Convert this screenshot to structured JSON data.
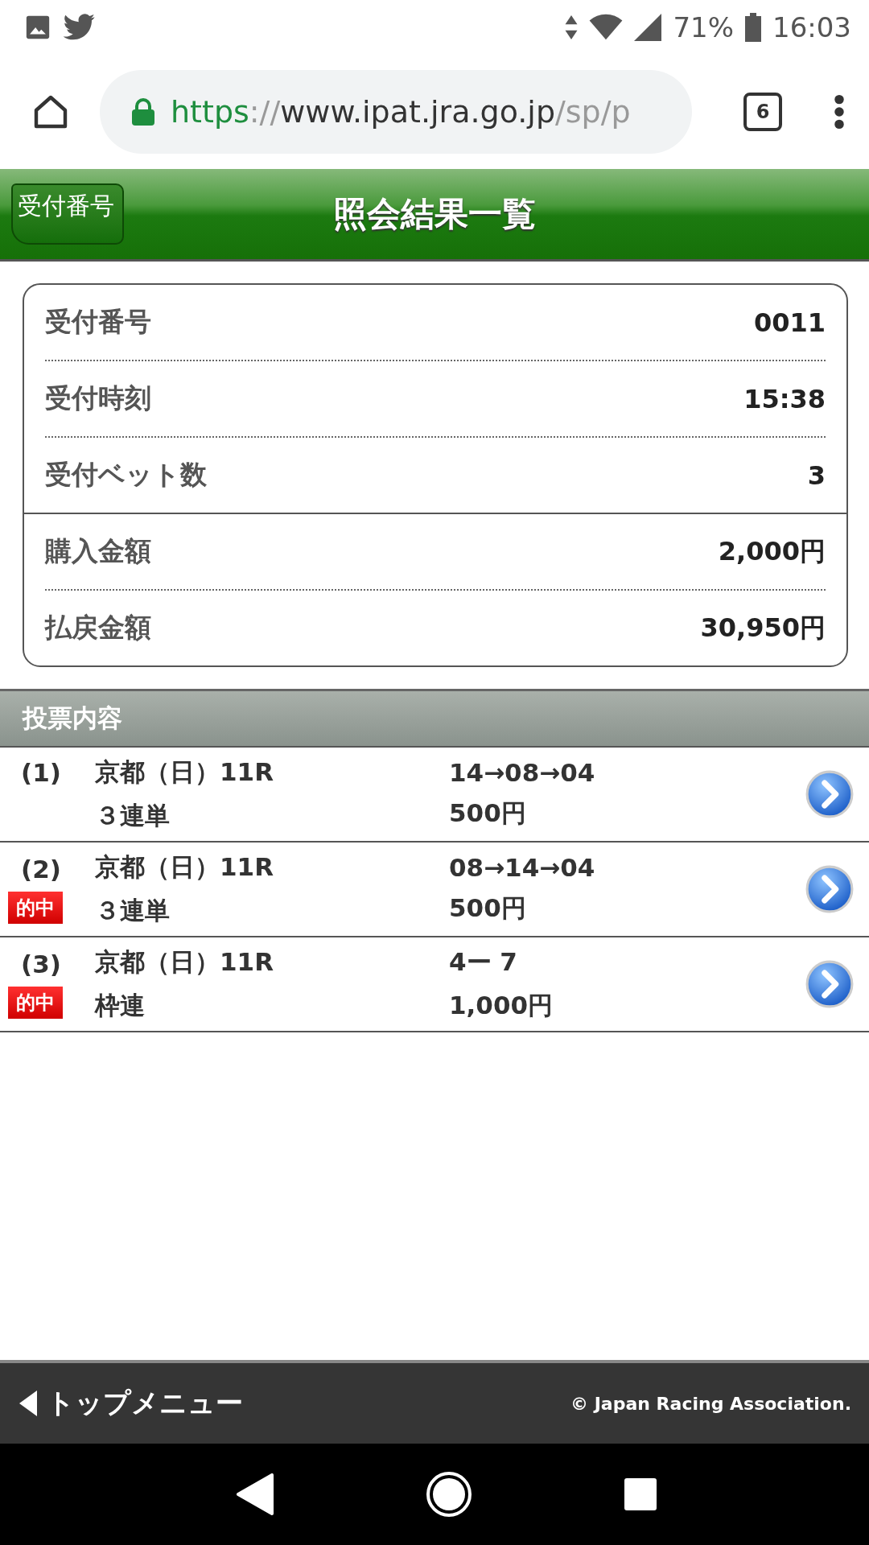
{
  "status_bar": {
    "battery": "71%",
    "time": "16:03"
  },
  "browser": {
    "url": [
      {
        "kind": "scheme",
        "text": "https"
      },
      {
        "kind": "dim",
        "text": "://"
      },
      {
        "kind": "host",
        "text": "www.ipat.jra.go.jp"
      },
      {
        "kind": "dim",
        "text": "/sp/p"
      }
    ],
    "tab_count": "6"
  },
  "header": {
    "back_label": "受付番号",
    "title": "照会結果一覧"
  },
  "summary": [
    [
      {
        "label": "受付番号",
        "value": "0011"
      },
      {
        "label": "受付時刻",
        "value": "15:38"
      },
      {
        "label": "受付ベット数",
        "value": "3"
      }
    ],
    [
      {
        "label": "購入金額",
        "value": "2,000円"
      },
      {
        "label": "払戻金額",
        "value": "30,950円"
      }
    ]
  ],
  "section_title": "投票内容",
  "bets": [
    {
      "number": "(1)",
      "race": "京都（日）11R",
      "type": "３連単",
      "hit": false,
      "combination": "14→08→04",
      "amount": "500円"
    },
    {
      "number": "(2)",
      "race": "京都（日）11R",
      "type": "３連単",
      "hit": true,
      "hit_label": "的中",
      "combination": "08→14→04",
      "amount": "500円"
    },
    {
      "number": "(3)",
      "race": "京都（日）11R",
      "type": "枠連",
      "hit": true,
      "hit_label": "的中",
      "combination": "4ー 7",
      "amount": "1,000円"
    }
  ],
  "footer": {
    "menu_link": "トップメニュー",
    "copyright": "© Japan Racing Association."
  }
}
